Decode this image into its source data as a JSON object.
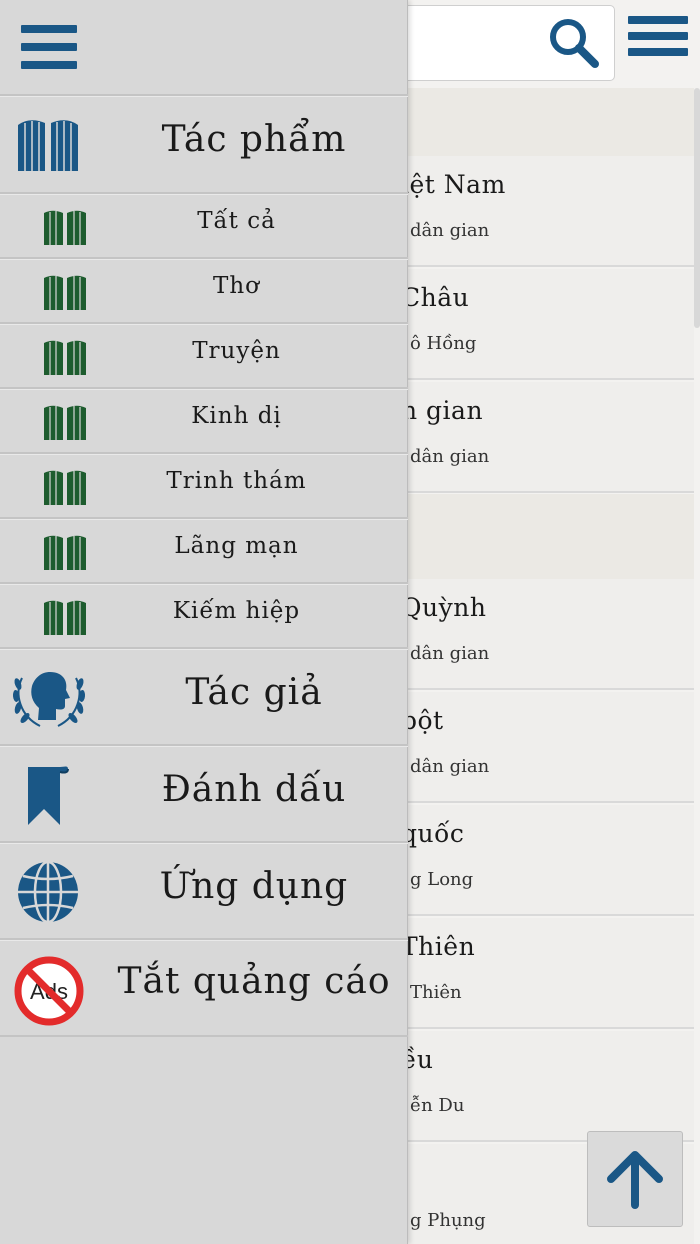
{
  "drawer": {
    "main_items": [
      {
        "label": "Tác phẩm",
        "icon": "book-open-icon"
      },
      {
        "label": "Tác giả",
        "icon": "author-laurel-icon"
      },
      {
        "label": "Đánh dấu",
        "icon": "bookmark-icon"
      },
      {
        "label": "Ứng dụng",
        "icon": "globe-icon"
      },
      {
        "label": "Tắt quảng cáo",
        "icon": "no-ads-icon"
      }
    ],
    "sub_items": [
      {
        "label": "Tất cả"
      },
      {
        "label": "Thơ"
      },
      {
        "label": "Truyện"
      },
      {
        "label": "Kinh dị"
      },
      {
        "label": "Trinh thám"
      },
      {
        "label": "Lãng mạn"
      },
      {
        "label": "Kiếm hiệp"
      }
    ],
    "no_ads_text": "Ads"
  },
  "list": [
    {
      "title": "iệt Nam",
      "subtitle": "dân gian"
    },
    {
      "title": "Châu",
      "subtitle": "ô Hồng"
    },
    {
      "title": "n gian",
      "subtitle": "dân gian"
    },
    {
      "title": "Quỳnh",
      "subtitle": "dân gian"
    },
    {
      "title": "bột",
      "subtitle": "dân gian"
    },
    {
      "title": "quốc",
      "subtitle": "g Long"
    },
    {
      "title": "Thiên",
      "subtitle": "Thiên"
    },
    {
      "title": "ều",
      "subtitle": "ễn Du"
    },
    {
      "title": "",
      "subtitle": "g Phụng"
    }
  ],
  "colors": {
    "primary_blue": "#1a5786",
    "book_green": "#1d5c2e",
    "no_ads_red": "#e32b2b"
  }
}
